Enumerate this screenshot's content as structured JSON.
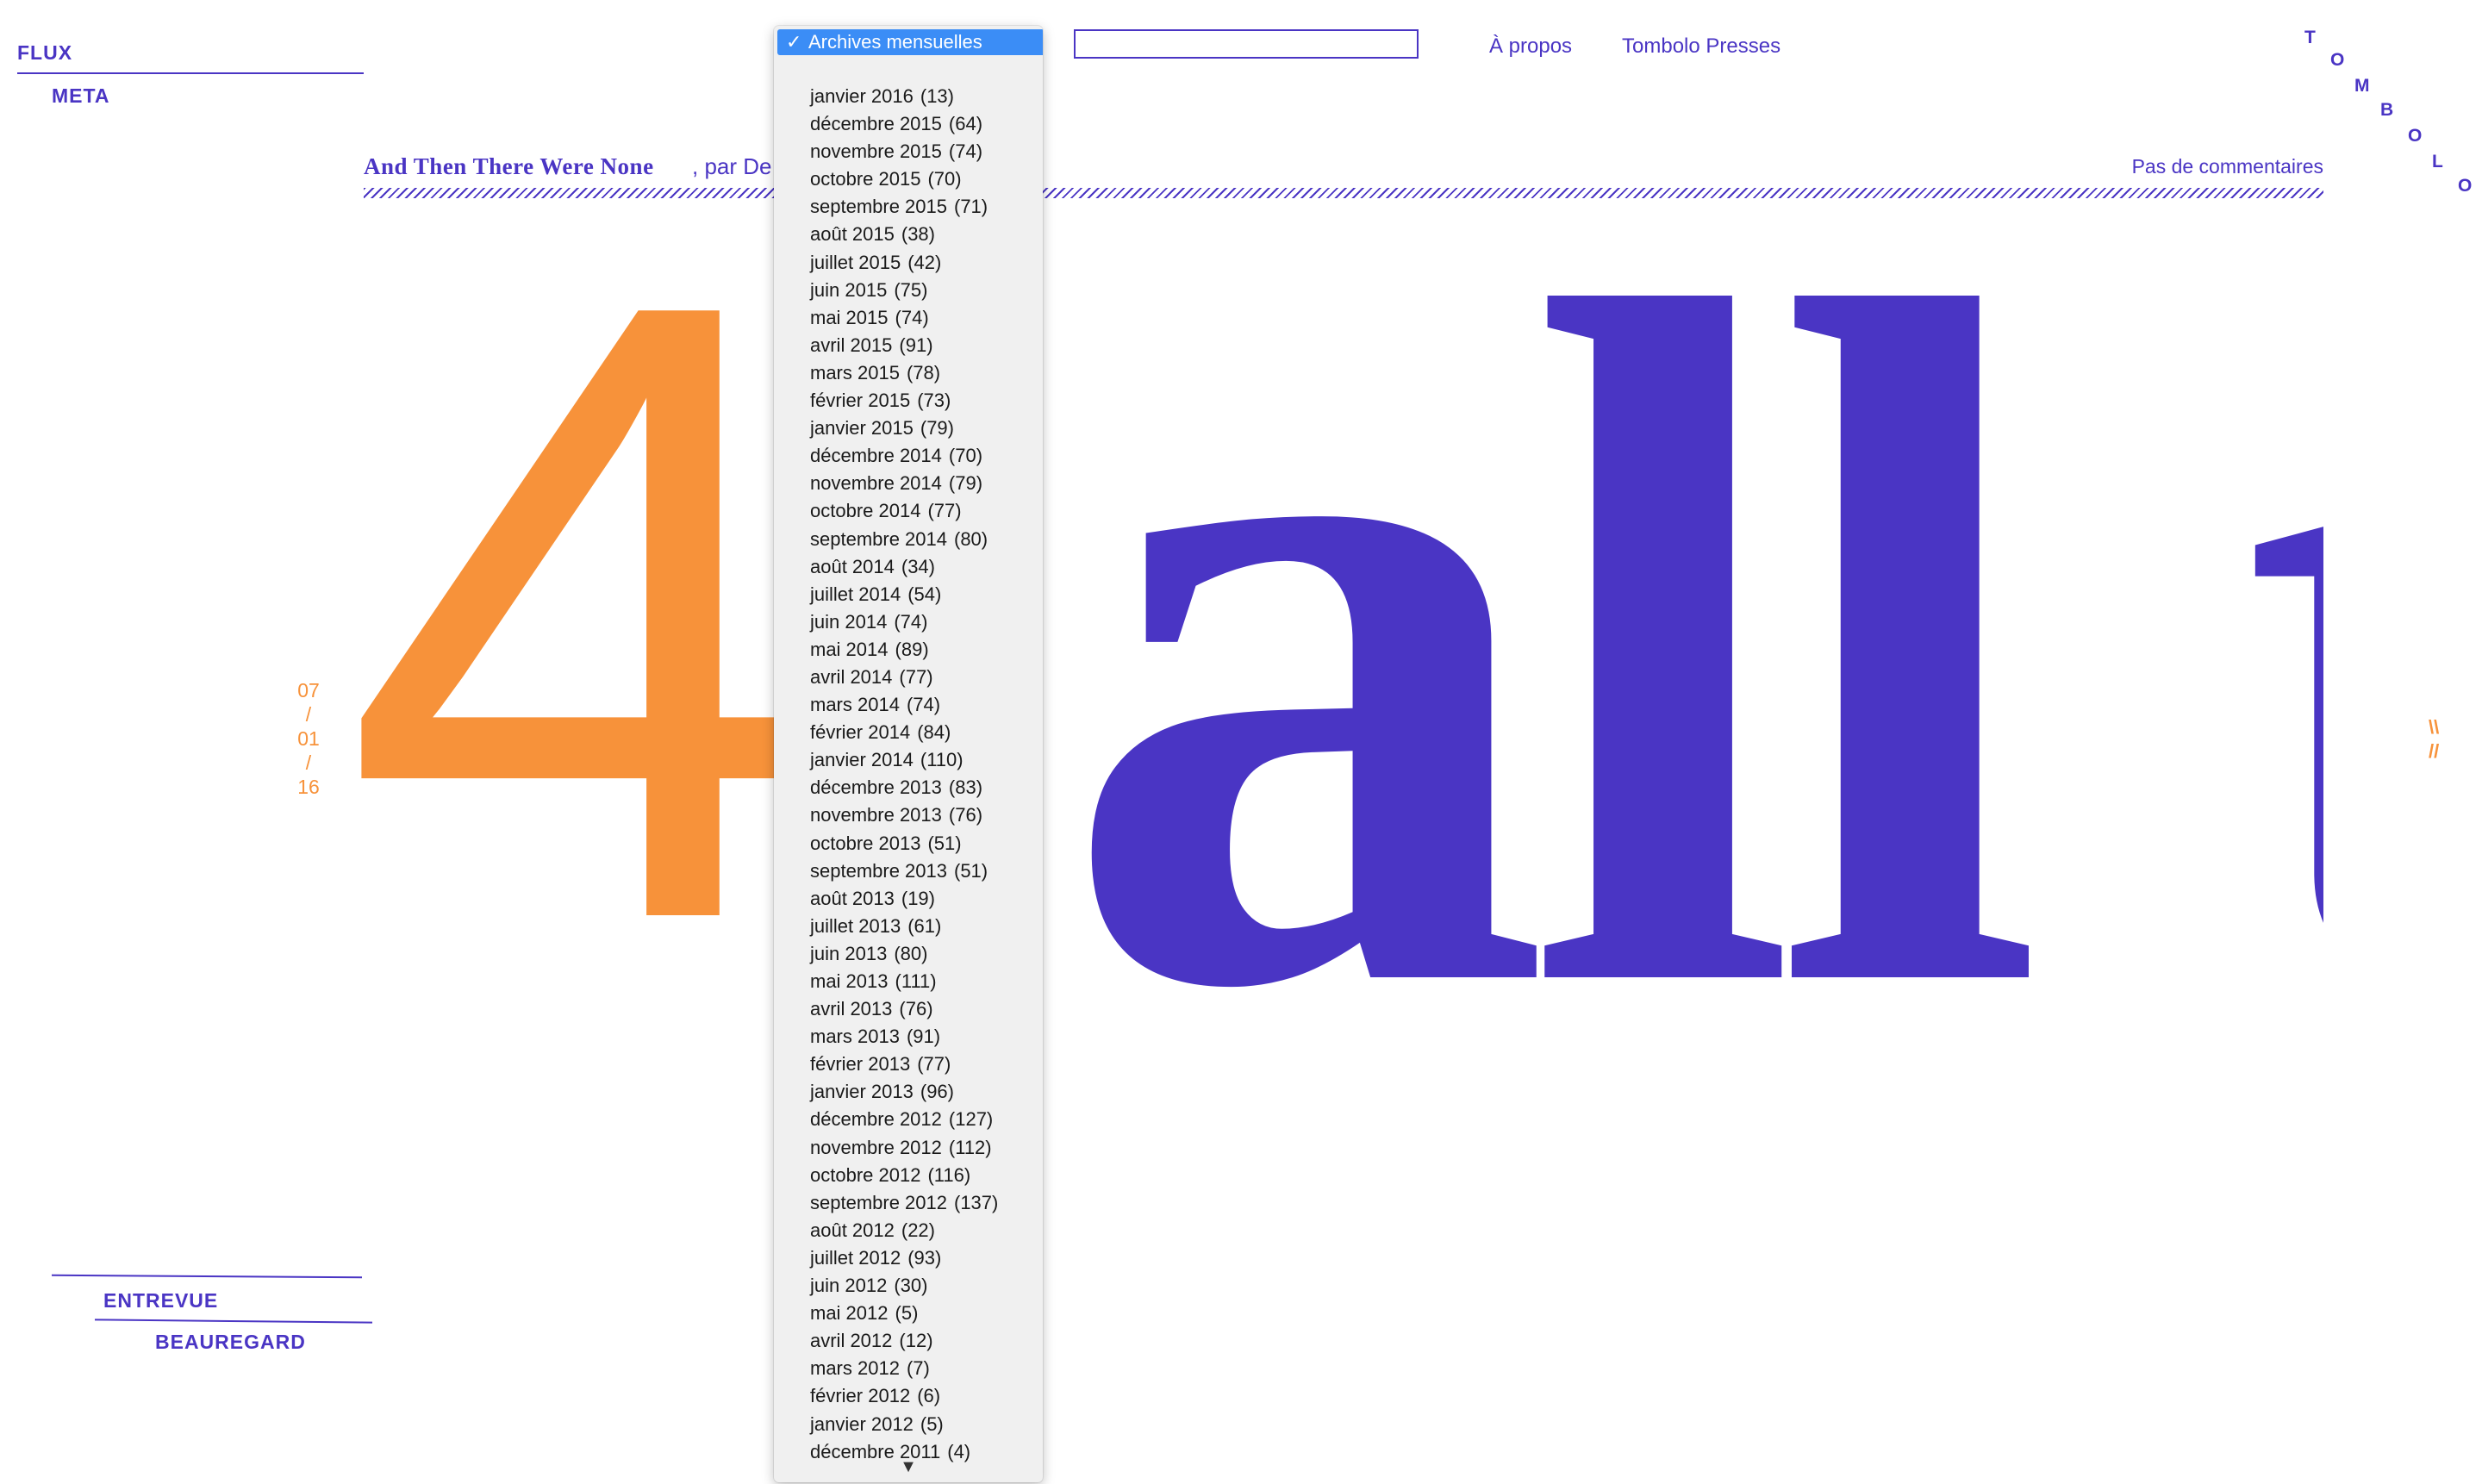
{
  "nav": {
    "flux": "FLUX",
    "meta": "META",
    "entrevue": "ENTREVUE",
    "beauregard": "BEAUREGARD"
  },
  "top_nav": {
    "search_value": "",
    "about": "À propos",
    "press": "Tombolo Presses"
  },
  "logo": {
    "letters": [
      "T",
      "O",
      "M",
      "B",
      "O",
      "L",
      "O"
    ]
  },
  "post": {
    "title": "And Then There Were None",
    "author_fragment": ", par De",
    "comments": "Pas de commentaires",
    "hero_number": "4",
    "hero_word": "all t",
    "date": {
      "day": "07",
      "month": "01",
      "year": "16",
      "separator": "/"
    },
    "nav_arrows_top": "\\\\",
    "nav_arrows_bottom": "//"
  },
  "colors": {
    "brand_purple": "#4a35c4",
    "accent_orange": "#f7923a",
    "selection_blue": "#3b8df6"
  },
  "archive_dropdown": {
    "selected_label": "Archives mensuelles",
    "check_icon": "✓",
    "scroll_down_icon": "▼",
    "items": [
      {
        "month": "janvier 2016",
        "count": "(13)"
      },
      {
        "month": "décembre 2015",
        "count": "(64)"
      },
      {
        "month": "novembre 2015",
        "count": "(74)"
      },
      {
        "month": "octobre 2015",
        "count": "(70)"
      },
      {
        "month": "septembre 2015",
        "count": "(71)"
      },
      {
        "month": "août 2015",
        "count": "(38)"
      },
      {
        "month": "juillet 2015",
        "count": "(42)"
      },
      {
        "month": "juin 2015",
        "count": "(75)"
      },
      {
        "month": "mai 2015",
        "count": "(74)"
      },
      {
        "month": "avril 2015",
        "count": "(91)"
      },
      {
        "month": "mars 2015",
        "count": "(78)"
      },
      {
        "month": "février 2015",
        "count": "(73)"
      },
      {
        "month": "janvier 2015",
        "count": "(79)"
      },
      {
        "month": "décembre 2014",
        "count": "(70)"
      },
      {
        "month": "novembre 2014",
        "count": "(79)"
      },
      {
        "month": "octobre 2014",
        "count": "(77)"
      },
      {
        "month": "septembre 2014",
        "count": "(80)"
      },
      {
        "month": "août 2014",
        "count": "(34)"
      },
      {
        "month": "juillet 2014",
        "count": "(54)"
      },
      {
        "month": "juin 2014",
        "count": "(74)"
      },
      {
        "month": "mai 2014",
        "count": "(89)"
      },
      {
        "month": "avril 2014",
        "count": "(77)"
      },
      {
        "month": "mars 2014",
        "count": "(74)"
      },
      {
        "month": "février 2014",
        "count": "(84)"
      },
      {
        "month": "janvier 2014",
        "count": "(110)"
      },
      {
        "month": "décembre 2013",
        "count": "(83)"
      },
      {
        "month": "novembre 2013",
        "count": "(76)"
      },
      {
        "month": "octobre 2013",
        "count": "(51)"
      },
      {
        "month": "septembre 2013",
        "count": "(51)"
      },
      {
        "month": "août 2013",
        "count": "(19)"
      },
      {
        "month": "juillet 2013",
        "count": "(61)"
      },
      {
        "month": "juin 2013",
        "count": "(80)"
      },
      {
        "month": "mai 2013",
        "count": "(111)"
      },
      {
        "month": "avril 2013",
        "count": "(76)"
      },
      {
        "month": "mars 2013",
        "count": "(91)"
      },
      {
        "month": "février 2013",
        "count": "(77)"
      },
      {
        "month": "janvier 2013",
        "count": "(96)"
      },
      {
        "month": "décembre 2012",
        "count": "(127)"
      },
      {
        "month": "novembre 2012",
        "count": "(112)"
      },
      {
        "month": "octobre 2012",
        "count": "(116)"
      },
      {
        "month": "septembre 2012",
        "count": "(137)"
      },
      {
        "month": "août 2012",
        "count": "(22)"
      },
      {
        "month": "juillet 2012",
        "count": "(93)"
      },
      {
        "month": "juin 2012",
        "count": "(30)"
      },
      {
        "month": "mai 2012",
        "count": "(5)"
      },
      {
        "month": "avril 2012",
        "count": "(12)"
      },
      {
        "month": "mars 2012",
        "count": "(7)"
      },
      {
        "month": "février 2012",
        "count": "(6)"
      },
      {
        "month": "janvier 2012",
        "count": "(5)"
      },
      {
        "month": "décembre 2011",
        "count": "(4)"
      }
    ]
  }
}
